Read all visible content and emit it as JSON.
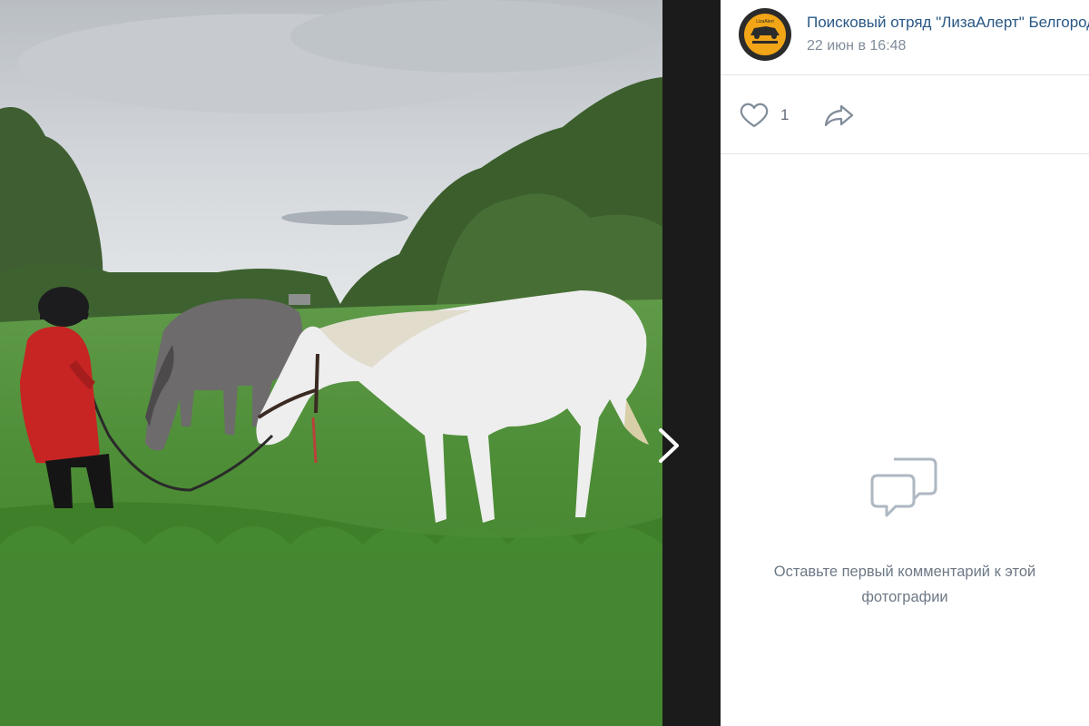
{
  "post": {
    "author": "Поисковый отряд \"ЛизаАлерт\" Белгородская область",
    "date": "22 июн в 16:48",
    "avatar_text": "LizaAlert",
    "likes": "1"
  },
  "comments": {
    "empty_text": "Оставьте первый комментарий к этой фотографии"
  },
  "icons": {
    "like": "heart-icon",
    "share": "share-arrow-icon",
    "comment": "comment-bubbles-icon",
    "next": "chevron-right-icon"
  },
  "colors": {
    "link": "#2a5885",
    "secondary": "#818c99",
    "divider": "#e1e3e6"
  }
}
